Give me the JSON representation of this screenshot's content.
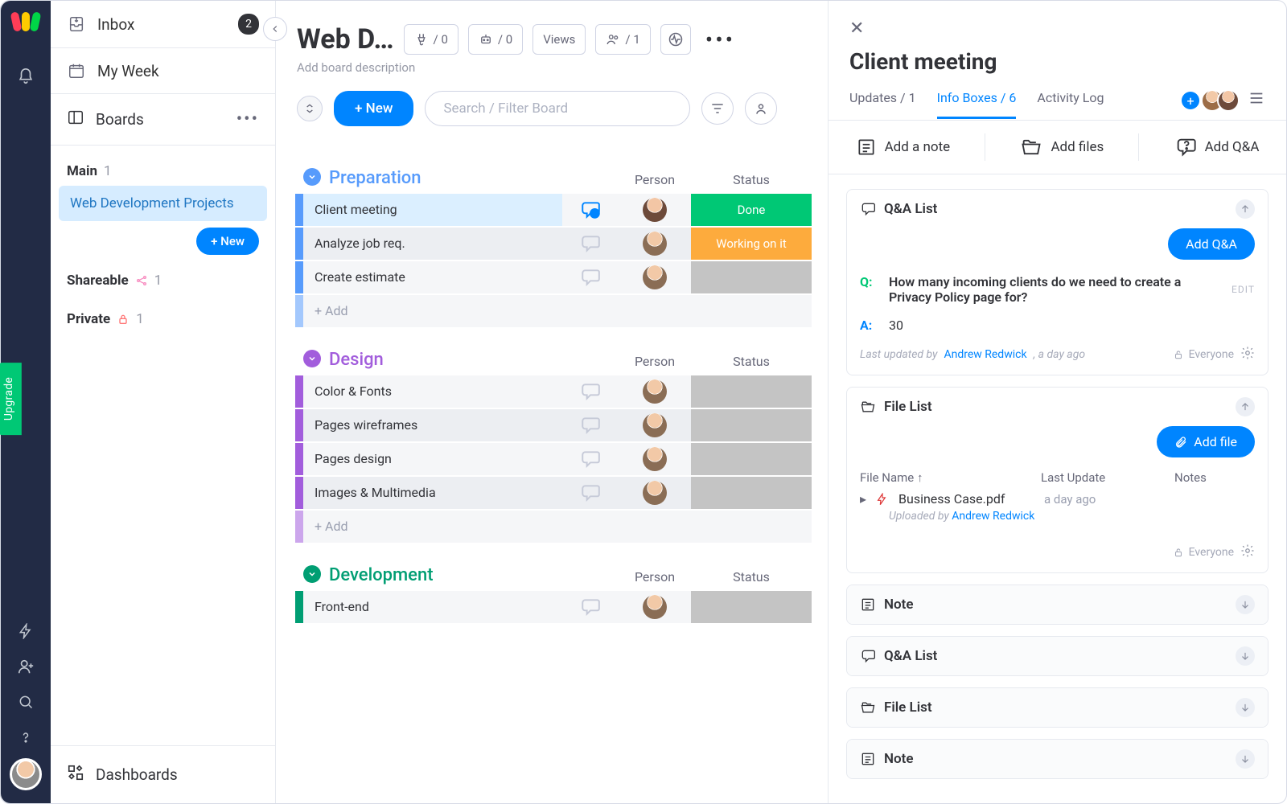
{
  "rail": {
    "upgrade": "Upgrade"
  },
  "sidebar": {
    "inbox": "Inbox",
    "inbox_count": "2",
    "myweek": "My Week",
    "boards": "Boards",
    "dashboards": "Dashboards",
    "main": {
      "label": "Main",
      "count": "1"
    },
    "board_active": "Web Development Projects",
    "new_btn": "+ New",
    "shareable": {
      "label": "Shareable",
      "count": "1"
    },
    "private": {
      "label": "Private",
      "count": "1"
    }
  },
  "board": {
    "title": "Web D…",
    "desc": "Add board description",
    "chip_auto": "/ 0",
    "chip_bot": "/ 0",
    "chip_views": "Views",
    "chip_people": "/ 1",
    "new_btn": "+ New",
    "search_ph": "Search / Filter Board"
  },
  "columns": {
    "person": "Person",
    "status": "Status"
  },
  "groups": [
    {
      "name": "Preparation",
      "color": "#579bfc",
      "rows": [
        {
          "name": "Client meeting",
          "status": "Done",
          "status_color": "#00c875",
          "selected": true,
          "chat": "active",
          "avatar": "f"
        },
        {
          "name": "Analyze job req.",
          "status": "Working on it",
          "status_color": "#fdab3d",
          "avatar": "m"
        },
        {
          "name": "Create estimate",
          "status": "",
          "status_color": "",
          "avatar": "m"
        }
      ],
      "add": "+ Add"
    },
    {
      "name": "Design",
      "color": "#a25ddc",
      "rows": [
        {
          "name": "Color & Fonts",
          "avatar": "m"
        },
        {
          "name": "Pages wireframes",
          "avatar": "m"
        },
        {
          "name": "Pages design",
          "avatar": "m"
        },
        {
          "name": "Images & Multimedia",
          "avatar": "m"
        }
      ],
      "add": "+ Add"
    },
    {
      "name": "Development",
      "color": "#009e73",
      "rows": [
        {
          "name": "Front-end",
          "avatar": "m"
        }
      ]
    }
  ],
  "panel": {
    "title": "Client meeting",
    "tabs": {
      "updates": "Updates / 1",
      "info": "Info Boxes / 6",
      "activity": "Activity Log"
    },
    "actions": {
      "note": "Add a note",
      "files": "Add files",
      "qa": "Add Q&A"
    },
    "qa_card": {
      "title": "Q&A List",
      "add": "Add Q&A",
      "question": "How many incoming clients do we need to create a Privacy Policy page for?",
      "answer": "30",
      "edit": "EDIT",
      "updated_prefix": "Last updated by ",
      "updated_by": "Andrew Redwick",
      "updated_suffix": ", a day ago",
      "visibility": "Everyone"
    },
    "file_card": {
      "title": "File List",
      "add": "Add file",
      "cols": {
        "name": "File Name ↑",
        "update": "Last Update",
        "notes": "Notes"
      },
      "file": "Business Case.pdf",
      "file_time": "a day ago",
      "uploaded_prefix": "Uploaded by ",
      "uploaded_by": "Andrew Redwick",
      "visibility": "Everyone"
    },
    "collapsed": [
      "Note",
      "Q&A List",
      "File List",
      "Note"
    ]
  }
}
